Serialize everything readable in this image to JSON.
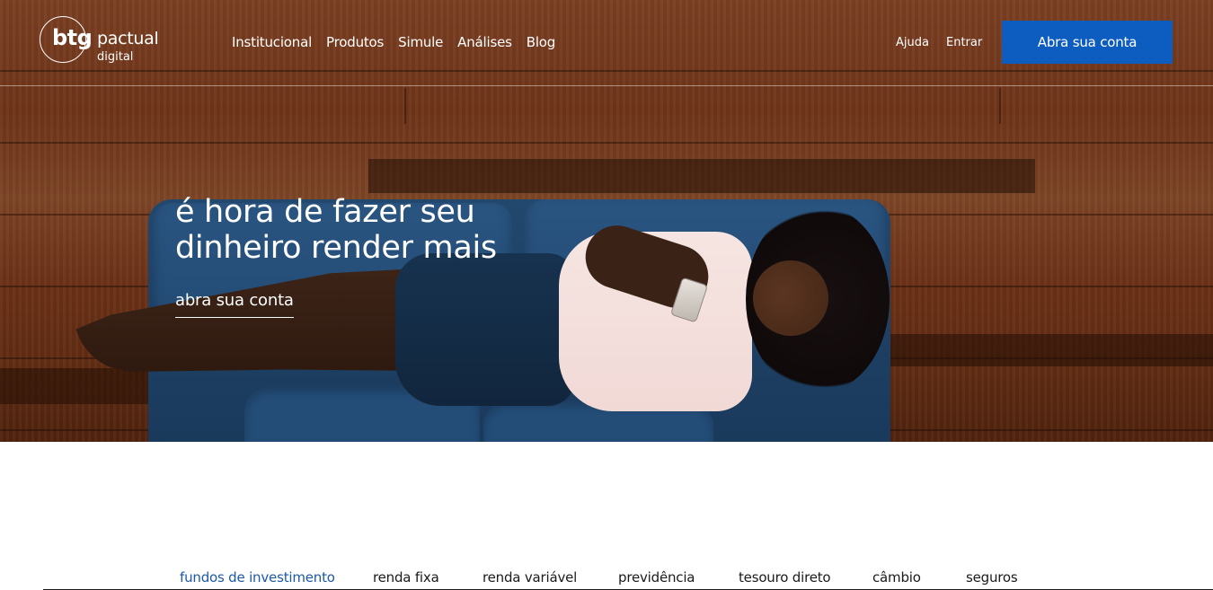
{
  "brand": {
    "logo_mark": "btg",
    "logo_name": "pactual",
    "logo_sub": "digital"
  },
  "nav": {
    "items": [
      {
        "label": "Institucional"
      },
      {
        "label": "Produtos"
      },
      {
        "label": "Simule"
      },
      {
        "label": "Análises"
      },
      {
        "label": "Blog"
      }
    ]
  },
  "utility": {
    "help_label": "Ajuda",
    "login_label": "Entrar",
    "cta_label": "Abra sua conta"
  },
  "hero": {
    "title_line1": "é hora de fazer seu",
    "title_line2": "dinheiro render mais",
    "link_label": "abra sua conta"
  },
  "products": {
    "tabs": [
      {
        "label": "fundos de investimento",
        "active": true
      },
      {
        "label": "renda fixa"
      },
      {
        "label": "renda variável"
      },
      {
        "label": "previdência"
      },
      {
        "label": "tesouro direto"
      },
      {
        "label": "câmbio"
      },
      {
        "label": "seguros"
      }
    ]
  },
  "colors": {
    "accent": "#0d5cbf",
    "active_tab": "#1b5aa6",
    "text_on_hero": "#ffffff"
  }
}
